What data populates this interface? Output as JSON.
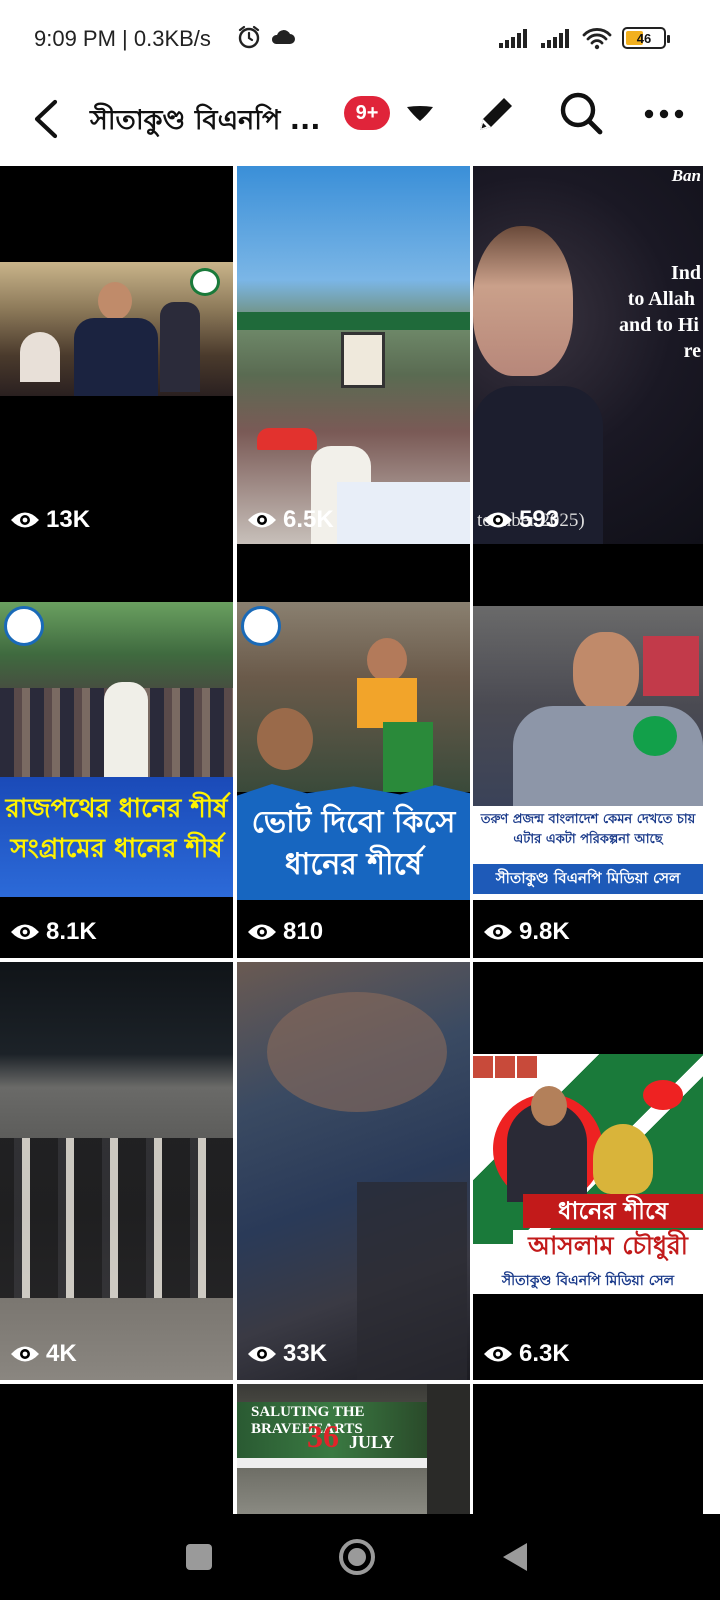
{
  "status_bar": {
    "time": "9:09 PM | 0.3KB/s",
    "battery": "46",
    "battery_level": 0.46,
    "icons": [
      "alarm-icon",
      "cloud-icon",
      "signal-icon",
      "signal-icon",
      "wifi-icon",
      "battery-icon"
    ]
  },
  "header": {
    "title": "সীতাকুণ্ড বিএনপি ...",
    "badge": "9+",
    "icons": [
      "back-arrow-icon",
      "dropdown-caret-icon",
      "edit-pencil-icon",
      "search-icon",
      "more-dots-icon"
    ],
    "badge_color": "#e0243a"
  },
  "videos": [
    {
      "views": "13K"
    },
    {
      "views": "6.5K"
    },
    {
      "views": "593",
      "overlay_lines": [
        "Ban",
        "Ind",
        "to Allah",
        "and to Hi",
        "re"
      ],
      "caption": "to  mber 2025)"
    },
    {
      "views": "8.1K",
      "banner_lines": [
        "রাজপথের ধানের শীর্ষ",
        "সংগ্রামের ধানের শীর্ষ"
      ]
    },
    {
      "views": "810",
      "banner_lines": [
        "ভোট দিবো কিসে",
        "ধানের শীর্ষে"
      ]
    },
    {
      "views": "9.8K",
      "banner_lines": [
        "তরুণ প্রজন্ম বাংলাদেশ কেমন দেখতে চায়",
        "এটার একটা পরিকল্পনা আছে"
      ],
      "footer": "সীতাকুণ্ড বিএনপি মিডিয়া সেল"
    },
    {
      "views": "4K"
    },
    {
      "views": "33K"
    },
    {
      "views": "6.3K",
      "banner_lines": [
        "ধানের শীষে",
        "আসলাম চৌধুরী"
      ],
      "footer": "সীতাকুণ্ড বিএনপি মিডিয়া সেল"
    },
    {
      "views": ""
    },
    {
      "views": "",
      "overlay_lines": [
        "SALUTING THE BRAVEHEARTS",
        "36",
        "JULY"
      ]
    },
    {
      "views": ""
    }
  ],
  "nav": {
    "icons": [
      "recents-square-icon",
      "home-circle-icon",
      "back-triangle-icon"
    ]
  }
}
